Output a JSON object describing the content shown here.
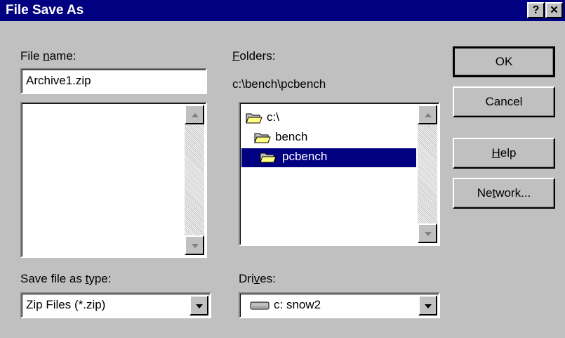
{
  "window": {
    "title": "File Save As",
    "help_glyph": "?",
    "close_glyph": "✕"
  },
  "file_name": {
    "label_pre": "File ",
    "label_u": "n",
    "label_post": "ame:",
    "value": "Archive1.zip"
  },
  "folders": {
    "label_pre": "",
    "label_u": "F",
    "label_post": "olders:",
    "current_path": "c:\\bench\\pcbench",
    "tree": [
      {
        "label": "c:\\",
        "icon": "open-folder-icon",
        "selected": false
      },
      {
        "label": "bench",
        "icon": "open-folder-icon",
        "selected": false
      },
      {
        "label": "pcbench",
        "icon": "open-folder-icon",
        "selected": true
      }
    ]
  },
  "save_type": {
    "label_pre": "Save file as ",
    "label_u": "t",
    "label_post": "ype:",
    "value": "Zip Files (*.zip)"
  },
  "drives": {
    "label_pre": "Dri",
    "label_u": "v",
    "label_post": "es:",
    "value": "c: snow2",
    "icon": "hard-drive-icon"
  },
  "buttons": {
    "ok": "OK",
    "cancel": "Cancel",
    "help_u": "H",
    "help_post": "elp",
    "network_pre": "Ne",
    "network_u": "t",
    "network_post": "work..."
  },
  "colors": {
    "titlebar": "#000080",
    "face": "#c0c0c0",
    "selection": "#000080"
  }
}
